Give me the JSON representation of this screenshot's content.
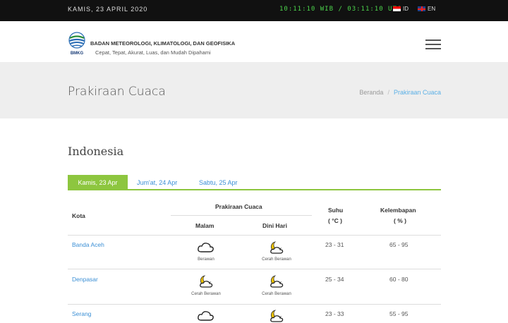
{
  "topbar": {
    "date": "KAMIS, 23 APRIL 2020",
    "clock": "10:11:10 WIB / 03:11:10 UTC",
    "lang_id": "ID",
    "lang_en": "EN"
  },
  "header": {
    "logo_text": "BMKG",
    "org_name": "BADAN METEOROLOGI, KLIMATOLOGI, DAN GEOFISIKA",
    "tagline": "Cepat, Tepat, Akurat, Luas, dan Mudah Dipahami"
  },
  "page": {
    "title": "Prakiraan Cuaca",
    "breadcrumb": {
      "home": "Beranda",
      "current": "Prakiraan Cuaca"
    }
  },
  "region": "Indonesia",
  "tabs": [
    "Kamis, 23 Apr",
    "Jum'at, 24 Apr",
    "Sabtu, 25 Apr"
  ],
  "table": {
    "headers": {
      "city": "Kota",
      "forecast": "Prakiraan Cuaca",
      "night": "Malam",
      "early": "Dini Hari",
      "temp": "Suhu",
      "temp_unit": "( °C )",
      "humidity": "Kelembapan",
      "humidity_unit": "( % )"
    },
    "rows": [
      {
        "city": "Banda Aceh",
        "night_icon": "cloud-icon",
        "night": "Berawan",
        "early_icon": "moon-cloud-icon",
        "early": "Cerah Berawan",
        "temp": "23 - 31",
        "humidity": "65 - 95"
      },
      {
        "city": "Denpasar",
        "night_icon": "moon-cloud-icon",
        "night": "Cerah Berawan",
        "early_icon": "moon-cloud-icon",
        "early": "Cerah Berawan",
        "temp": "25 - 34",
        "humidity": "60 - 80"
      },
      {
        "city": "Serang",
        "night_icon": "cloud-icon",
        "night": "",
        "early_icon": "moon-cloud-icon",
        "early": "",
        "temp": "23 - 33",
        "humidity": "55 - 95"
      }
    ]
  },
  "colors": {
    "accent_green": "#8dc63f",
    "link_blue": "#3b8fd5",
    "clock_green": "#4cd44c"
  }
}
